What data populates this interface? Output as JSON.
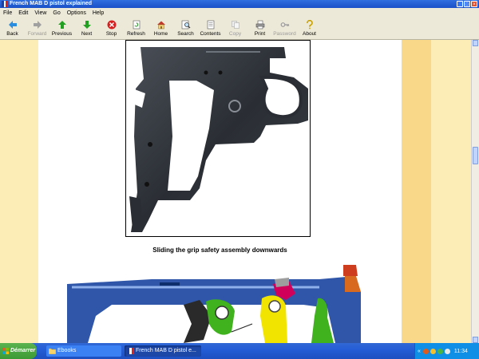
{
  "window": {
    "title": "French MAB D pistol explained"
  },
  "menu": [
    "File",
    "Edit",
    "View",
    "Go",
    "Options",
    "Help"
  ],
  "toolbar": [
    {
      "label": "Back",
      "icon": "back-arrow-icon",
      "enabled": true
    },
    {
      "label": "Forward",
      "icon": "forward-arrow-icon",
      "enabled": false
    },
    {
      "label": "Previous",
      "icon": "up-arrow-icon",
      "enabled": true
    },
    {
      "label": "Next",
      "icon": "down-arrow-icon",
      "enabled": true
    },
    {
      "label": "Stop",
      "icon": "stop-icon",
      "enabled": true
    },
    {
      "label": "Refresh",
      "icon": "refresh-icon",
      "enabled": true
    },
    {
      "label": "Home",
      "icon": "home-icon",
      "enabled": true
    },
    {
      "label": "Search",
      "icon": "search-icon",
      "enabled": true
    },
    {
      "label": "Contents",
      "icon": "contents-icon",
      "enabled": true
    },
    {
      "label": "Copy",
      "icon": "copy-icon",
      "enabled": false
    },
    {
      "label": "Print",
      "icon": "print-icon",
      "enabled": true
    },
    {
      "label": "Password",
      "icon": "key-icon",
      "enabled": false
    },
    {
      "label": "About",
      "icon": "help-icon",
      "enabled": true
    }
  ],
  "content": {
    "caption": "Sliding the grip safety assembly downwards"
  },
  "taskbar": {
    "start_label": "Démarrer",
    "tasks": [
      {
        "label": "Ebooks"
      },
      {
        "label": "French MAB D pistol e..."
      }
    ],
    "tray_chevron": "«",
    "clock": "11:34"
  },
  "colors": {
    "titlebar": "#1a50c8",
    "page_background": "#fcf1c4",
    "right_band": "#f9d889",
    "diagram_frame": "#2f56a8",
    "diagram_yellow": "#f0e400",
    "diagram_green": "#3fb21e",
    "diagram_magenta": "#d0005a"
  }
}
